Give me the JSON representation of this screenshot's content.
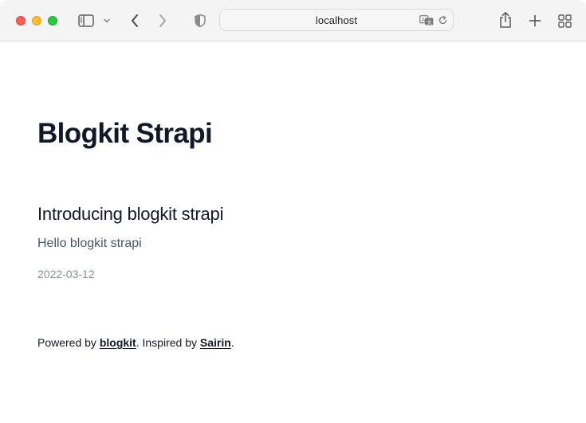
{
  "browser": {
    "address": "localhost",
    "colors": {
      "close": "#ff5f57",
      "minimize": "#febc2e",
      "zoom": "#28c840",
      "toolbar_bg": "#f4f4f4",
      "icon": "#5f5f5f"
    },
    "icons": {
      "sidebar": "sidebar-icon",
      "sidebar_menu": "chevron-down-icon",
      "back": "chevron-left-icon",
      "forward": "chevron-right-icon",
      "privacy": "shield-icon",
      "translate": "translate-icon",
      "reload": "reload-icon",
      "share": "share-icon",
      "new_tab": "plus-icon",
      "tab_overview": "grid-icon"
    }
  },
  "page": {
    "site_title": "Blogkit Strapi",
    "posts": [
      {
        "title": "Introducing blogkit strapi",
        "excerpt": "Hello blogkit strapi",
        "date": "2022-03-12"
      }
    ],
    "footer": {
      "prefix": "Powered by ",
      "link1": "blogkit",
      "middle": ". Inspired by ",
      "link2": "Sairin",
      "suffix": "."
    },
    "colors": {
      "heading": "#111827",
      "excerpt": "#4b5563",
      "date": "#8a8f98"
    }
  }
}
